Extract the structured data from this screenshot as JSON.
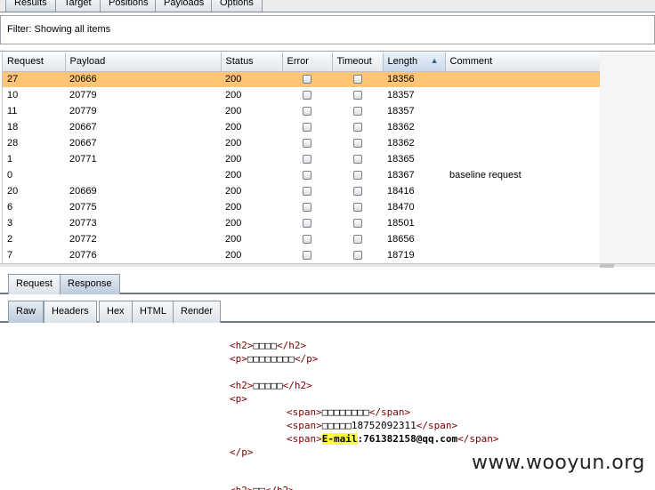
{
  "top_tabs": [
    {
      "label": "Results",
      "active": true
    },
    {
      "label": "Target"
    },
    {
      "label": "Positions"
    },
    {
      "label": "Payloads"
    },
    {
      "label": "Options"
    }
  ],
  "filter": {
    "text": "Filter:  Showing all items"
  },
  "table": {
    "columns": [
      "Request",
      "Payload",
      "Status",
      "Error",
      "Timeout",
      "Length",
      "Comment"
    ],
    "sorted_column": "Length",
    "rows": [
      {
        "request": "27",
        "payload": "20666",
        "status": "200",
        "length": "18356",
        "comment": "",
        "selected": true
      },
      {
        "request": "10",
        "payload": "20779",
        "status": "200",
        "length": "18357",
        "comment": ""
      },
      {
        "request": "11",
        "payload": "20779",
        "status": "200",
        "length": "18357",
        "comment": ""
      },
      {
        "request": "18",
        "payload": "20667",
        "status": "200",
        "length": "18362",
        "comment": ""
      },
      {
        "request": "28",
        "payload": "20667",
        "status": "200",
        "length": "18362",
        "comment": ""
      },
      {
        "request": "1",
        "payload": "20771",
        "status": "200",
        "length": "18365",
        "comment": ""
      },
      {
        "request": "0",
        "payload": "",
        "status": "200",
        "length": "18367",
        "comment": "baseline request"
      },
      {
        "request": "20",
        "payload": "20669",
        "status": "200",
        "length": "18416",
        "comment": ""
      },
      {
        "request": "6",
        "payload": "20775",
        "status": "200",
        "length": "18470",
        "comment": ""
      },
      {
        "request": "3",
        "payload": "20773",
        "status": "200",
        "length": "18501",
        "comment": ""
      },
      {
        "request": "2",
        "payload": "20772",
        "status": "200",
        "length": "18656",
        "comment": ""
      },
      {
        "request": "7",
        "payload": "20776",
        "status": "200",
        "length": "18719",
        "comment": ""
      }
    ]
  },
  "sub_tabs": [
    {
      "label": "Request"
    },
    {
      "label": "Response",
      "active": true
    }
  ],
  "view_tabs": [
    {
      "label": "Raw",
      "active": true
    },
    {
      "label": "Headers"
    },
    {
      "label": "Hex"
    },
    {
      "label": "HTML"
    },
    {
      "label": "Render"
    }
  ],
  "code": {
    "h2_a_text": "□□□□",
    "p_a_text": "□□□□□□□□",
    "h2_b_text": "□□□□□",
    "span1_text": "□□□□□□□□",
    "span2_text": "□□□□□18752092311",
    "span3_label": "E-mail",
    "span3_value": ":761382158@qq.com",
    "h2_c_text": "□□"
  },
  "watermark": "www.wooyun.org"
}
